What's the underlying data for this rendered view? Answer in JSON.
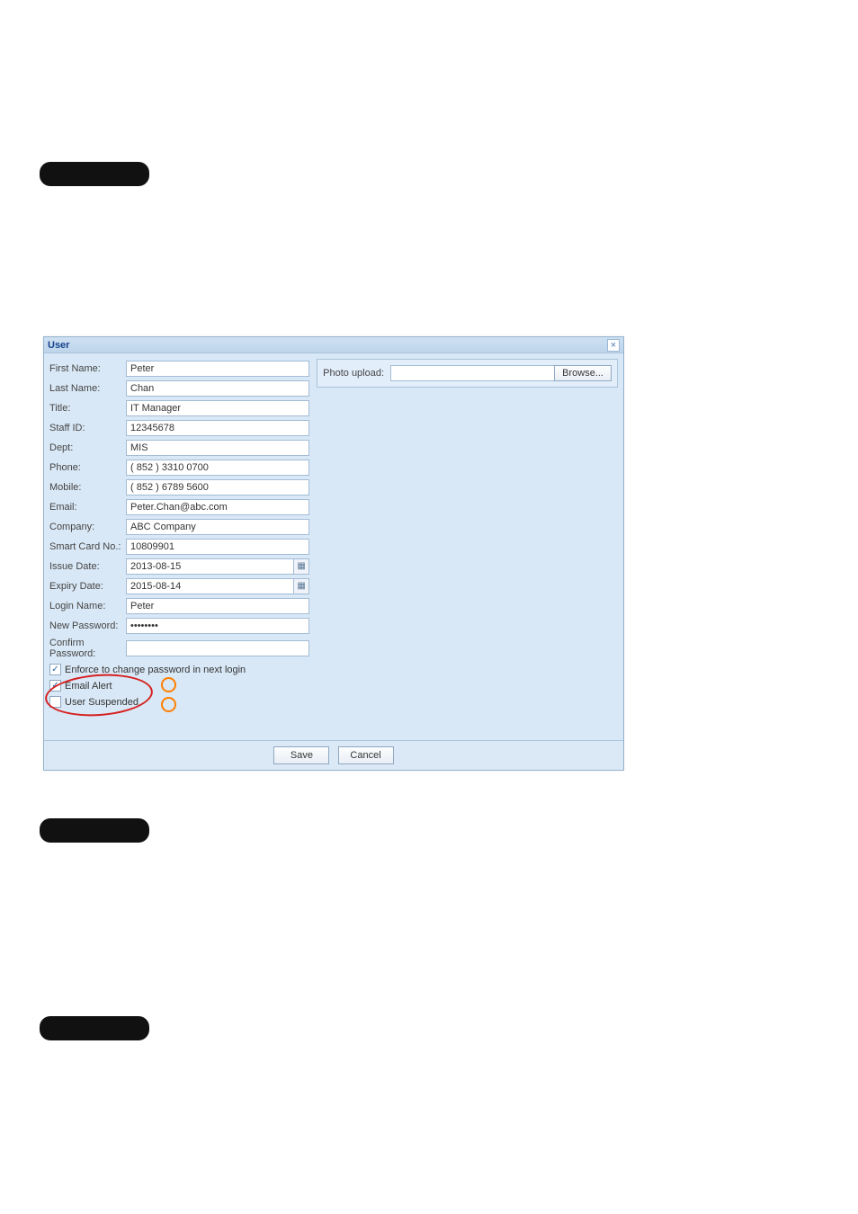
{
  "dialog": {
    "title": "User",
    "close": "×",
    "labels": {
      "first_name": "First Name:",
      "last_name": "Last Name:",
      "title": "Title:",
      "staff_id": "Staff ID:",
      "dept": "Dept:",
      "phone": "Phone:",
      "mobile": "Mobile:",
      "email": "Email:",
      "company": "Company:",
      "smart_card": "Smart Card No.:",
      "issue_date": "Issue Date:",
      "expiry_date": "Expiry Date:",
      "login_name": "Login Name:",
      "new_password": "New Password:",
      "confirm_password": "Confirm Password:",
      "photo_upload": "Photo upload:"
    },
    "values": {
      "first_name": "Peter",
      "last_name": "Chan",
      "title": "IT Manager",
      "staff_id": "12345678",
      "dept": "MIS",
      "phone": "( 852 ) 3310 0700",
      "mobile": "( 852 ) 6789 5600",
      "email": "Peter.Chan@abc.com",
      "company": "ABC Company",
      "smart_card": "10809901",
      "issue_date": "2013-08-15",
      "expiry_date": "2015-08-14",
      "login_name": "Peter",
      "new_password": "••••••••",
      "confirm_password": "",
      "photo_path": ""
    },
    "checkboxes": {
      "enforce_label": "Enforce to change password in next login",
      "enforce_checked": true,
      "email_alert_label": "Email Alert",
      "email_alert_checked": true,
      "suspended_label": "User Suspended",
      "suspended_checked": false
    },
    "buttons": {
      "browse": "Browse...",
      "save": "Save",
      "cancel": "Cancel"
    },
    "checkmark": "✓"
  }
}
